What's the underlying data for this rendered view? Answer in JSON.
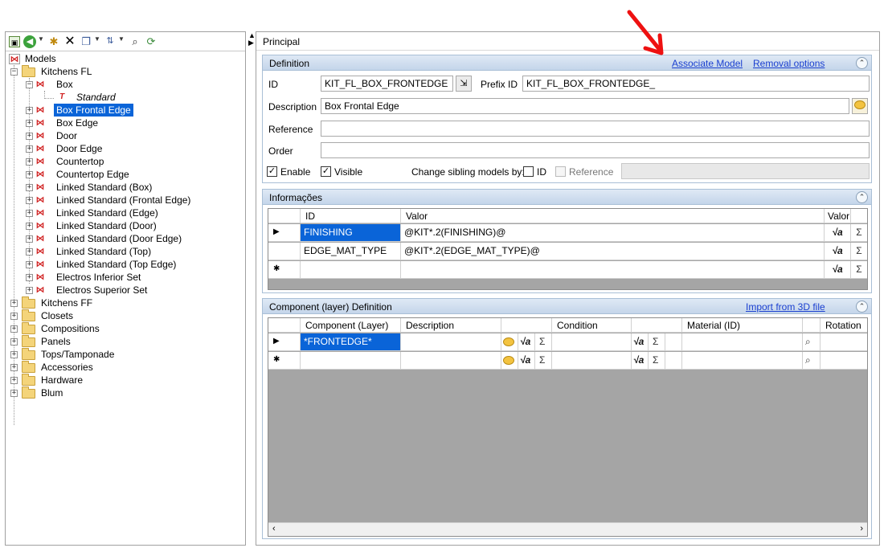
{
  "tree": {
    "root": "Models",
    "nodes": [
      {
        "label": "Kitchens FL"
      },
      {
        "label": "Box"
      },
      {
        "label": "Standard"
      },
      {
        "label": "Box Frontal Edge"
      },
      {
        "label": "Box Edge"
      },
      {
        "label": "Door"
      },
      {
        "label": "Door Edge"
      },
      {
        "label": "Countertop"
      },
      {
        "label": "Countertop Edge"
      },
      {
        "label": "Linked Standard (Box)"
      },
      {
        "label": "Linked Standard (Frontal Edge)"
      },
      {
        "label": "Linked Standard (Edge)"
      },
      {
        "label": "Linked Standard (Door)"
      },
      {
        "label": "Linked Standard (Door Edge)"
      },
      {
        "label": "Linked Standard (Top)"
      },
      {
        "label": "Linked Standard (Top Edge)"
      },
      {
        "label": "Electros Inferior Set"
      },
      {
        "label": "Electros Superior Set"
      },
      {
        "label": "Kitchens FF"
      },
      {
        "label": "Closets"
      },
      {
        "label": "Compositions"
      },
      {
        "label": "Panels"
      },
      {
        "label": "Tops/Tamponade"
      },
      {
        "label": "Accessories"
      },
      {
        "label": "Hardware"
      },
      {
        "label": "Blum"
      }
    ]
  },
  "right": {
    "title": "Principal",
    "definition": {
      "header": "Definition",
      "associate_model": "Associate Model",
      "removal_options": "Removal options",
      "id_label": "ID",
      "id_value": "KIT_FL_BOX_FRONTEDGE",
      "prefix_label": "Prefix ID",
      "prefix_value": "KIT_FL_BOX_FRONTEDGE_",
      "description_label": "Description",
      "description_value": "Box Frontal Edge",
      "reference_label": "Reference",
      "reference_value": "",
      "order_label": "Order",
      "order_value": "",
      "enable_label": "Enable",
      "visible_label": "Visible",
      "change_sibling_label": "Change sibling models by:",
      "sib_id_label": "ID",
      "sib_reference_label": "Reference"
    },
    "informacoes": {
      "header": "Informações",
      "columns": [
        "ID",
        "Valor",
        "Valor"
      ],
      "rows": [
        {
          "id": "FINISHING",
          "valor": "@KIT*.2(FINISHING)@"
        },
        {
          "id": "EDGE_MAT_TYPE",
          "valor": "@KIT*.2(EDGE_MAT_TYPE)@"
        }
      ]
    },
    "component": {
      "header": "Component (layer) Definition",
      "import_link": "Import from 3D file",
      "columns": [
        "Component (Layer)",
        "Description",
        "Condition",
        "Material (ID)",
        "Rotation"
      ],
      "rows": [
        {
          "layer": "*FRONTEDGE*"
        }
      ]
    }
  },
  "annotation": {
    "arrow_color": "#ee1111"
  }
}
